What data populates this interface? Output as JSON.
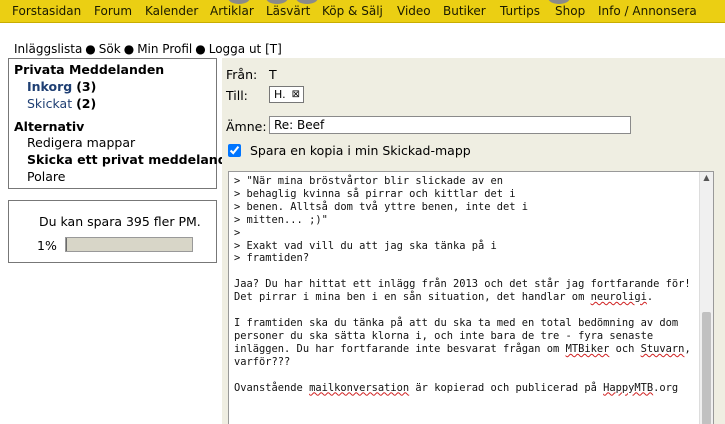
{
  "nav": {
    "items": [
      "Forstasidan",
      "Forum",
      "Kalender",
      "Artiklar",
      "Läsvärt",
      "Köp & Sälj",
      "Video",
      "Butiker",
      "Turtips",
      "Shop",
      "Info / Annonsera"
    ]
  },
  "links": {
    "inbox_list": "Inläggslista",
    "search": "Sök",
    "profile": "Min Profil",
    "logout": "Logga ut [T]",
    "separator": "●"
  },
  "sidebar": {
    "title": "Privata Meddelanden",
    "inbox_label": "Inkorg",
    "inbox_count": "(3)",
    "sent_label": "Skickat",
    "sent_count": "(2)",
    "alt_title": "Alternativ",
    "edit_folders": "Redigera mappar",
    "send_pm": "Skicka ett privat meddelande",
    "friends": "Polare"
  },
  "quota": {
    "text": "Du kan spara 395 fler PM.",
    "percent_label": "1%",
    "percent_value": 0.01
  },
  "message": {
    "from_label": "Från:",
    "from_value": "T",
    "to_label": "Till:",
    "to_recipient": "H.",
    "remove_icon": "⊠",
    "subject_label": "Ämne:",
    "subject_value": "Re: Beef",
    "copy_label": "Spara en kopia i min Skickad-mapp",
    "body_lines": [
      "> \"När mina bröstvårtor blir slickade av en",
      "> behaglig kvinna så pirrar och kittlar det i",
      "> benen. Alltså dom två yttre benen, inte det i",
      "> mitten... ;)\"",
      ">",
      "> Exakt vad vill du att jag ska tänka på i",
      "> framtiden?",
      "",
      "Jaa? Du har hittat ett inlägg från 2013 och det står jag fortfarande för!",
      "Det pirrar i mina ben i en sån situation, det handlar om neuroligi.",
      "",
      "I framtiden ska du tänka på att du ska ta med en total bedömning av dom",
      "personer du ska sätta klorna i, och inte bara de tre - fyra senaste",
      "inläggen. Du har fortfarande inte besvarat frågan om MTBiker och Stuvarn,",
      "varför???",
      "",
      "Ovanstående mailkonversation är kopierad och publicerad på HappyMTB.org"
    ]
  },
  "colors": {
    "nav_bg": "#ebcf13",
    "panel_bg": "#efeee2",
    "link_blue": "#1f3f73"
  }
}
